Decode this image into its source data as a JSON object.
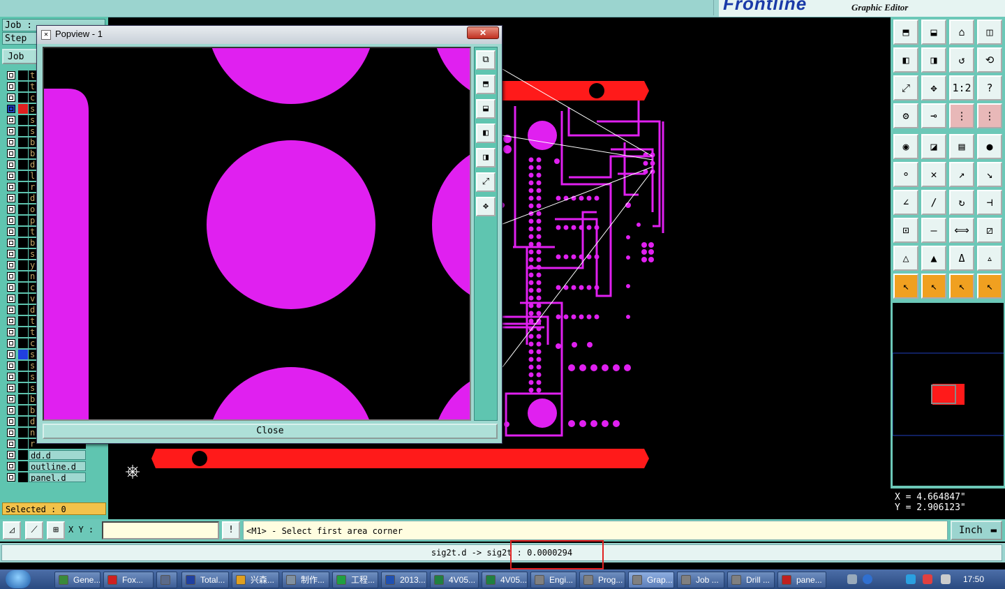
{
  "app": {
    "brand_logo": "Frontline",
    "brand_subtitle": "Graphic Editor"
  },
  "left_panel": {
    "job_label": "Job : ",
    "step_label": "Step",
    "job_button": "Job",
    "layers": [
      {
        "name": "t",
        "swatch": "#000000"
      },
      {
        "name": "t",
        "swatch": "#000000"
      },
      {
        "name": "c",
        "swatch": "#000000"
      },
      {
        "name": "s",
        "swatch": "#e02020"
      },
      {
        "name": "s",
        "swatch": "#000000"
      },
      {
        "name": "s",
        "swatch": "#000000"
      },
      {
        "name": "b",
        "swatch": "#000000"
      },
      {
        "name": "b",
        "swatch": "#000000"
      },
      {
        "name": "d",
        "swatch": "#000000"
      },
      {
        "name": "l",
        "swatch": "#000000"
      },
      {
        "name": "r",
        "swatch": "#000000"
      },
      {
        "name": "d",
        "swatch": "#000000"
      },
      {
        "name": "o",
        "swatch": "#000000"
      },
      {
        "name": "p",
        "swatch": "#000000"
      },
      {
        "name": "t",
        "swatch": "#000000"
      },
      {
        "name": "b",
        "swatch": "#000000"
      },
      {
        "name": "s",
        "swatch": "#000000"
      },
      {
        "name": "y",
        "swatch": "#000000"
      },
      {
        "name": "n",
        "swatch": "#000000"
      },
      {
        "name": "c",
        "swatch": "#000000"
      },
      {
        "name": "v",
        "swatch": "#000000"
      },
      {
        "name": "d",
        "swatch": "#000000"
      },
      {
        "name": "t",
        "swatch": "#000000"
      },
      {
        "name": "t",
        "swatch": "#000000"
      },
      {
        "name": "c",
        "swatch": "#000000"
      },
      {
        "name": "s",
        "swatch": "#2040e0"
      },
      {
        "name": "s",
        "swatch": "#000000"
      },
      {
        "name": "s",
        "swatch": "#000000"
      },
      {
        "name": "s",
        "swatch": "#000000"
      },
      {
        "name": "b",
        "swatch": "#000000"
      },
      {
        "name": "b",
        "swatch": "#000000"
      },
      {
        "name": "d",
        "swatch": "#000000"
      },
      {
        "name": "n",
        "swatch": "#000000"
      },
      {
        "name": "r",
        "swatch": "#000000"
      },
      {
        "name": "dd.d",
        "swatch": "#000000"
      },
      {
        "name": "outline.d",
        "swatch": "#000000",
        "boxed": true
      },
      {
        "name": "panel.d",
        "swatch": "#000000",
        "boxed": true
      }
    ],
    "selected_text": "Selected : 0"
  },
  "popview": {
    "title": "Popview - 1",
    "close_label": "Close",
    "close_x": "✕"
  },
  "right_panel": {
    "tool_rows": 10,
    "coords": {
      "x": "X = 4.664847\"",
      "y": "Y = 2.906123\""
    }
  },
  "command_bar": {
    "xy_label": "X Y :",
    "xy_value": "",
    "warn_label": "!",
    "prompt": "<M1> - Select first area corner",
    "unit": "Inch"
  },
  "status_bar": {
    "message": "sig2t.d -> sig2t : 0.0000294"
  },
  "taskbar": {
    "tasks": [
      {
        "label": "Gene...",
        "color": "#3a8a3a"
      },
      {
        "label": "Fox...",
        "color": "#d02020"
      },
      {
        "label": "",
        "color": "#5a6a8a"
      },
      {
        "label": "Total...",
        "color": "#2040a0"
      },
      {
        "label": "兴森...",
        "color": "#e0a020"
      },
      {
        "label": "制作...",
        "color": "#8090a0"
      },
      {
        "label": "工程...",
        "color": "#20a040"
      },
      {
        "label": "2013...",
        "color": "#2050b0"
      },
      {
        "label": "4V05...",
        "color": "#208040"
      },
      {
        "label": "4V05...",
        "color": "#208040"
      },
      {
        "label": "Engi...",
        "color": "#808080"
      },
      {
        "label": "Prog...",
        "color": "#808080"
      },
      {
        "label": "Grap...",
        "color": "#808080",
        "active": true
      },
      {
        "label": "Job ...",
        "color": "#808080"
      },
      {
        "label": "Drill ...",
        "color": "#808080"
      },
      {
        "label": "pane...",
        "color": "#c02020"
      }
    ],
    "clock": "17:50"
  },
  "colors": {
    "copper": "#e020f0",
    "outline_red": "#ff1a1a",
    "panel_teal": "#5fc5b0"
  }
}
